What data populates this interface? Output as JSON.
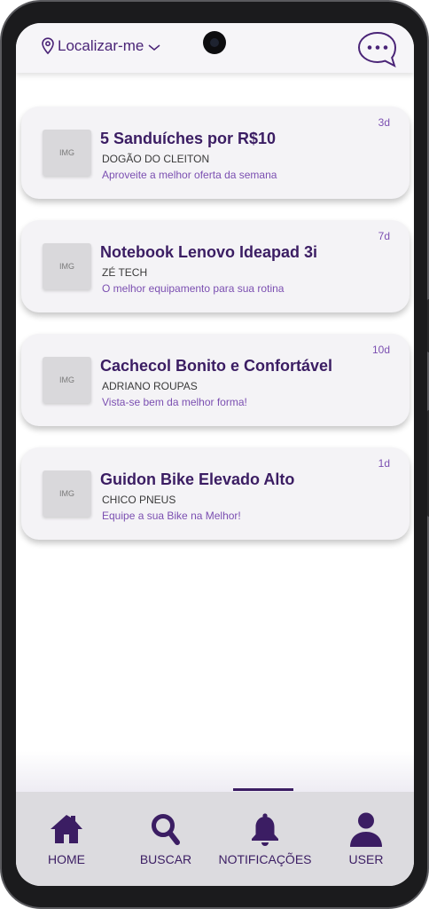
{
  "header": {
    "location_label": "Localizar-me"
  },
  "notifications": [
    {
      "title": "5 Sanduíches por R$10",
      "shop": "DOGÃO DO CLEITON",
      "description": "Aproveite a melhor oferta da semana",
      "age": "3d",
      "thumb_label": "IMG"
    },
    {
      "title": "Notebook Lenovo Ideapad 3i",
      "shop": "ZÉ TECH",
      "description": "O melhor equipamento para sua rotina",
      "age": "7d",
      "thumb_label": "IMG"
    },
    {
      "title": "Cachecol Bonito e Confortável",
      "shop": "ADRIANO ROUPAS",
      "description": "Vista-se bem da melhor forma!",
      "age": "10d",
      "thumb_label": "IMG"
    },
    {
      "title": "Guidon Bike Elevado Alto",
      "shop": "CHICO PNEUS",
      "description": "Equipe a sua Bike na Melhor!",
      "age": "1d",
      "thumb_label": "IMG"
    }
  ],
  "tabbar": {
    "active": "NOTIFICAÇÕES",
    "tabs": [
      {
        "label": "HOME",
        "icon": "home-icon"
      },
      {
        "label": "BUSCAR",
        "icon": "search-icon"
      },
      {
        "label": "NOTIFICAÇÕES",
        "icon": "bell-icon"
      },
      {
        "label": "USER",
        "icon": "user-icon"
      }
    ]
  },
  "colors": {
    "accent": "#3b1d63",
    "secondary_text": "#7b4fb1",
    "card_bg": "#f4f3f6",
    "tabbar_bg": "#dcdbdf"
  }
}
